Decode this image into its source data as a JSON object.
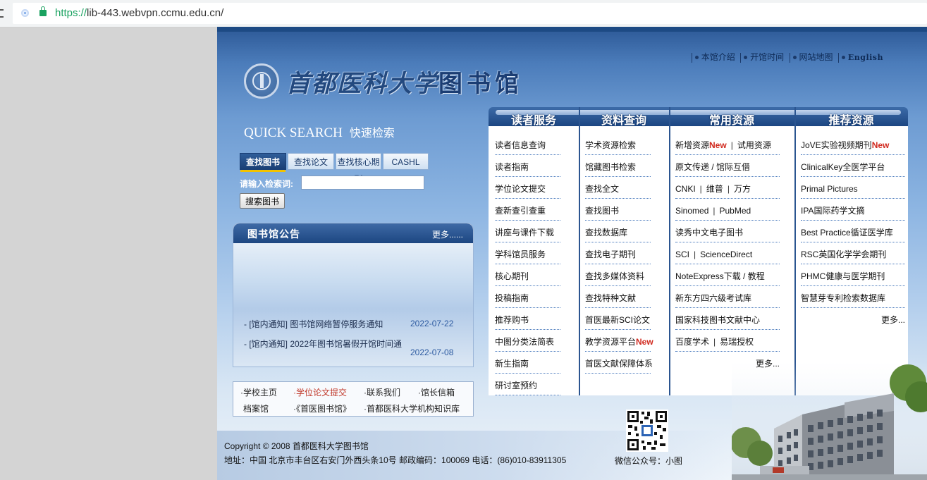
{
  "browser": {
    "url_scheme": "https://",
    "url_rest": "lib-443.webvpn.ccmu.edu.cn/"
  },
  "header": {
    "top_links": [
      "本馆介绍",
      "开馆时间",
      "网站地图",
      "English"
    ],
    "logo_university": "首都医科大学",
    "logo_library": "图书馆"
  },
  "quick_search": {
    "title_en": "QUICK SEARCH",
    "title_cn": "快速检索",
    "tabs": [
      "查找图书",
      "查找论文",
      "查找核心期刊",
      "CASHL"
    ],
    "active_tab": "查找图书",
    "input_label": "请输入检索词:",
    "input_value": "",
    "button_label": "搜索图书"
  },
  "notice": {
    "title": "图书馆公告",
    "more": "更多......",
    "items": [
      {
        "text": "- [馆内通知] 图书馆网络暂停服务通知",
        "date": "2022-07-22"
      },
      {
        "text": "- [馆内通知] 2022年图书馆暑假开馆时间通",
        "date": "2022-07-08"
      }
    ]
  },
  "quick_links": {
    "row1": [
      "·学校主页",
      "·学位论文提交",
      "·联系我们",
      "·馆长信箱"
    ],
    "row2": [
      "档案馆",
      "·《首医图书馆》",
      "·首都医科大学机构知识库"
    ]
  },
  "nav": {
    "reader_services": {
      "title": "读者服务",
      "items": [
        "读者信息查询",
        "读者指南",
        "学位论文提交",
        "查新查引查重",
        "讲座与课件下载",
        "学科馆员服务",
        "核心期刊",
        "投稿指南",
        "推荐购书",
        "中图分类法简表",
        "新生指南",
        "研讨室预约"
      ]
    },
    "resource_query": {
      "title": "资料查询",
      "items": [
        "学术资源检索",
        "馆藏图书检索",
        "查找全文",
        "查找图书",
        "查找数据库",
        "查找电子期刊",
        "查找多媒体资料",
        "查找特种文献",
        "首医最新SCI论文",
        "教学资源平台",
        "首医文献保障体系"
      ],
      "new_badge": "New"
    },
    "common_resources": {
      "title": "常用资源",
      "items": [
        [
          "新增资源",
          "试用资源"
        ],
        [
          "原文传递 / 馆际互借"
        ],
        [
          "CNKI",
          "维普",
          "万方"
        ],
        [
          "Sinomed",
          "PubMed"
        ],
        [
          "读秀中文电子图书"
        ],
        [
          "SCI",
          "ScienceDirect"
        ],
        [
          "NoteExpress下载 / 教程"
        ],
        [
          "新东方四六级考试库"
        ],
        [
          "国家科技图书文献中心"
        ],
        [
          "百度学术",
          "易瑞授权"
        ]
      ],
      "new_badge": "New",
      "more": "更多..."
    },
    "recommended": {
      "title": "推荐资源",
      "items": [
        "JoVE实验视频期刊",
        "ClinicalKey全医学平台",
        "Primal Pictures",
        "IPA国际药学文摘",
        "Best Practice循证医学库",
        "RSC英国化学学会期刊",
        "PHMC健康与医学期刊",
        "智慧芽专利检索数据库"
      ],
      "new_badge": "New",
      "more": "更多..."
    }
  },
  "qr": {
    "caption": "微信公众号：小图"
  },
  "footer": {
    "copyright": "Copyright © 2008 首都医科大学图书馆",
    "address": "地址：中国 北京市丰台区右安门外西头条10号 邮政编码：100069 电话：(86)010-83911305"
  }
}
